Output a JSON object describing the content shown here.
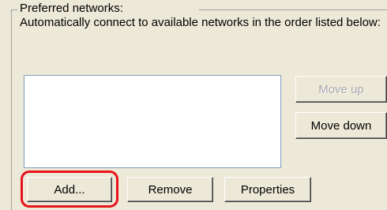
{
  "group": {
    "legend": "Preferred networks:",
    "description": "Automatically connect to available networks in the order listed below:"
  },
  "network_list": {
    "items": []
  },
  "buttons": {
    "move_up": "Move up",
    "move_down": "Move down",
    "add": "Add...",
    "remove": "Remove",
    "properties": "Properties"
  },
  "states": {
    "move_up_enabled": false
  },
  "colors": {
    "dialog_bg": "#ece9d8",
    "highlight": "#e8141a",
    "disabled_text": "#a7a6aa",
    "list_border": "#7f9db9"
  }
}
